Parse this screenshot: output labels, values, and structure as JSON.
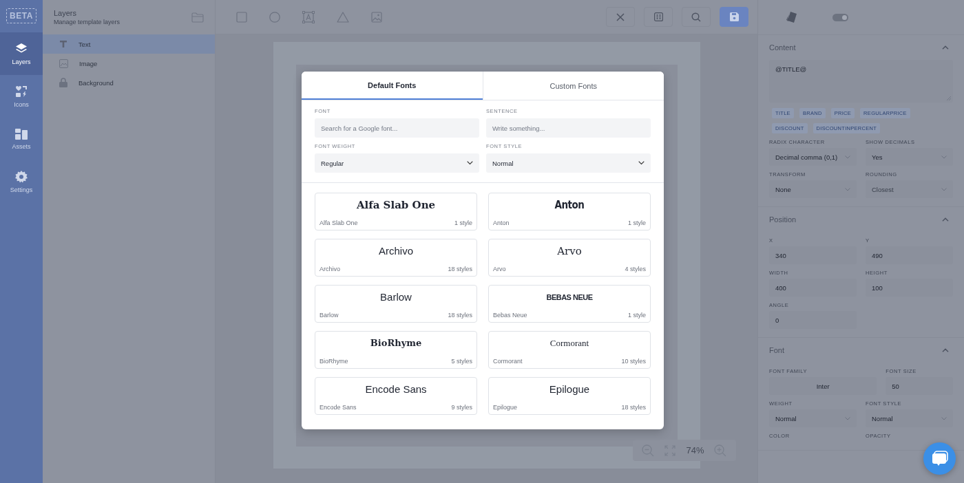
{
  "rail": {
    "logo": "BETA",
    "items": [
      {
        "kind": "layers",
        "label": "Layers",
        "selected": true
      },
      {
        "kind": "icons",
        "label": "Icons",
        "selected": false
      },
      {
        "kind": "assets",
        "label": "Assets",
        "selected": false
      },
      {
        "kind": "settings",
        "label": "Settings",
        "selected": false
      }
    ]
  },
  "layers_panel": {
    "title": "Layers",
    "subtitle": "Manage template layers",
    "layers": [
      {
        "kind": "text",
        "label": "Text",
        "selected": true
      },
      {
        "kind": "image",
        "label": "Image",
        "selected": false
      },
      {
        "kind": "locked",
        "label": "Background",
        "selected": false
      }
    ]
  },
  "zoom": {
    "reading": "74%"
  },
  "modal": {
    "tabs": [
      {
        "label": "Default Fonts",
        "selected": true
      },
      {
        "label": "Custom Fonts",
        "selected": false
      }
    ],
    "fields": [
      {
        "kind": "text",
        "label": "FONT",
        "placeholder": "Search for a Google font..."
      },
      {
        "kind": "text",
        "label": "SENTENCE",
        "placeholder": "Write something..."
      },
      {
        "kind": "select",
        "label": "FONT WEIGHT",
        "value": "Regular"
      },
      {
        "kind": "select",
        "label": "FONT STYLE",
        "value": "Normal"
      }
    ],
    "fonts": [
      {
        "kind": "slab",
        "preview": "Alfa Slab One",
        "name": "Alfa Slab One",
        "styles": "1 style"
      },
      {
        "kind": "condensed",
        "preview": "Anton",
        "name": "Anton",
        "styles": "1 style"
      },
      {
        "kind": "sans",
        "preview": "Archivo",
        "name": "Archivo",
        "styles": "18 styles"
      },
      {
        "kind": "serif",
        "preview": "Arvo",
        "name": "Arvo",
        "styles": "4 styles"
      },
      {
        "kind": "sans",
        "preview": "Barlow",
        "name": "Barlow",
        "styles": "18 styles"
      },
      {
        "kind": "caps",
        "preview": "BEBAS NEUE",
        "name": "Bebas Neue",
        "styles": "1 style"
      },
      {
        "kind": "serif-wide",
        "preview": "BioRhyme",
        "name": "BioRhyme",
        "styles": "5 styles"
      },
      {
        "kind": "serif-light",
        "preview": "Cormorant",
        "name": "Cormorant",
        "styles": "10 styles"
      },
      {
        "kind": "sans",
        "preview": "Encode Sans",
        "name": "Encode Sans",
        "styles": "9 styles"
      },
      {
        "kind": "sans",
        "preview": "Epilogue",
        "name": "Epilogue",
        "styles": "18 styles"
      }
    ]
  },
  "properties": {
    "toggle": {
      "on": true
    },
    "sections": [
      {
        "title": "Content",
        "expanded": true,
        "content": {
          "value": "@TITLE@",
          "tags": [
            "TITLE",
            "BRAND",
            "PRICE",
            "REGULARPRICE",
            "DISCOUNT",
            "DISCOUNTINPERCENT"
          ]
        },
        "rows": [
          [
            {
              "kind": "select",
              "label": "RADIX CHARACTER",
              "value": "Decimal comma (0,1)",
              "disabled": false
            },
            {
              "kind": "select",
              "label": "SHOW DECIMALS",
              "value": "Yes",
              "disabled": false
            }
          ],
          [
            {
              "kind": "select",
              "label": "TRANSFORM",
              "value": "None",
              "disabled": false
            },
            {
              "kind": "select",
              "label": "ROUNDING",
              "value": "Closest",
              "disabled": true
            }
          ]
        ]
      },
      {
        "title": "Position",
        "expanded": true,
        "rows": [
          [
            {
              "kind": "input",
              "label": "X",
              "value": "340",
              "disabled": false
            },
            {
              "kind": "input",
              "label": "Y",
              "value": "490",
              "disabled": false
            }
          ],
          [
            {
              "kind": "input",
              "label": "WIDTH",
              "value": "400",
              "disabled": false
            },
            {
              "kind": "input",
              "label": "HEIGHT",
              "value": "100",
              "disabled": false
            }
          ],
          [
            {
              "kind": "input",
              "label": "ANGLE",
              "value": "0",
              "disabled": false
            },
            {
              "kind": "blank"
            }
          ]
        ]
      },
      {
        "title": "Font",
        "expanded": true,
        "rows": [
          [
            {
              "kind": "family",
              "label": "FONT FAMILY",
              "value": "Inter",
              "disabled": false
            },
            {
              "kind": "input",
              "label": "FONT SIZE",
              "value": "50",
              "disabled": false
            }
          ],
          [
            {
              "kind": "select",
              "label": "WEIGHT",
              "value": "Normal",
              "disabled": false
            },
            {
              "kind": "select",
              "label": "FONT STYLE",
              "value": "Normal",
              "disabled": false
            }
          ],
          [
            {
              "kind": "label",
              "label": "COLOR"
            },
            {
              "kind": "label",
              "label": "OPACITY"
            }
          ]
        ]
      }
    ]
  }
}
